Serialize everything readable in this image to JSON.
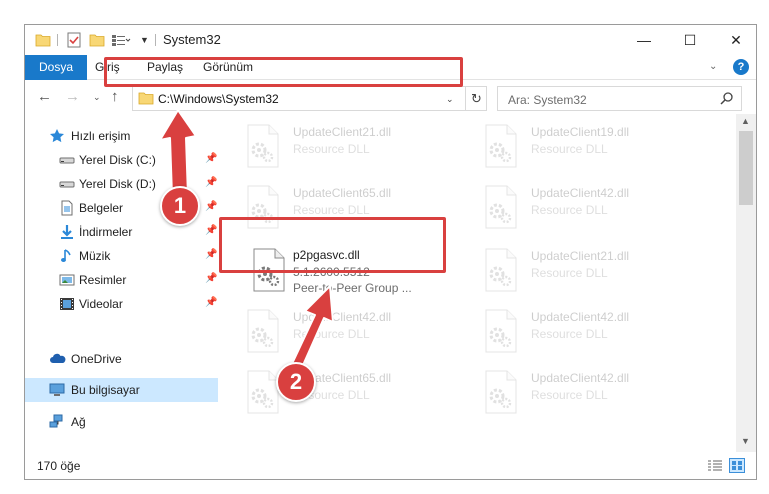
{
  "window": {
    "title": "System32",
    "minimize": "—",
    "maximize": "☐",
    "close": "✕"
  },
  "ribbon": {
    "tabs": [
      "Dosya",
      "Giriş",
      "Paylaş",
      "Görünüm"
    ],
    "expand": "⌄",
    "help": "?"
  },
  "nav": {
    "back": "←",
    "forward": "→",
    "recent": "⌄",
    "up": "↑",
    "address": "C:\\Windows\\System32",
    "address_drop": "⌄",
    "refresh": "↻",
    "search_placeholder": "Ara: System32"
  },
  "sidebar": {
    "items": [
      {
        "label": "Hızlı erişim",
        "icon": "star-icon",
        "pinned": false
      },
      {
        "label": "Yerel Disk (C:)",
        "icon": "drive-icon",
        "pinned": true
      },
      {
        "label": "Yerel Disk (D:)",
        "icon": "drive-icon",
        "pinned": true
      },
      {
        "label": "Belgeler",
        "icon": "documents-icon",
        "pinned": true
      },
      {
        "label": "İndirmeler",
        "icon": "download-icon",
        "pinned": true
      },
      {
        "label": "Müzik",
        "icon": "music-icon",
        "pinned": true
      },
      {
        "label": "Resimler",
        "icon": "pictures-icon",
        "pinned": true
      },
      {
        "label": "Videolar",
        "icon": "video-icon",
        "pinned": true
      },
      {
        "label": "OneDrive",
        "icon": "cloud-icon",
        "pinned": false
      },
      {
        "label": "Bu bilgisayar",
        "icon": "computer-icon",
        "pinned": false
      },
      {
        "label": "Ağ",
        "icon": "network-icon",
        "pinned": false
      }
    ]
  },
  "files": [
    {
      "name": "UpdateClient21.dll",
      "desc": "Resource DLL",
      "desc2": ""
    },
    {
      "name": "UpdateClient19.dll",
      "desc": "Resource DLL",
      "desc2": ""
    },
    {
      "name": "UpdateClient65.dll",
      "desc": "Resource DLL",
      "desc2": ""
    },
    {
      "name": "UpdateClient42.dll",
      "desc": "Resource DLL",
      "desc2": ""
    },
    {
      "name": "p2pgasvc.dll",
      "desc": "5.1.2600.5512",
      "desc2": "Peer-to-Peer Group ..."
    },
    {
      "name": "UpdateClient21.dll",
      "desc": "Resource DLL",
      "desc2": ""
    },
    {
      "name": "UpdateClient42.dll",
      "desc": "Resource DLL",
      "desc2": ""
    },
    {
      "name": "UpdateClient42.dll",
      "desc": "Resource DLL",
      "desc2": ""
    },
    {
      "name": "UpdateClient65.dll",
      "desc": "Resource DLL",
      "desc2": ""
    },
    {
      "name": "UpdateClient42.dll",
      "desc": "Resource DLL",
      "desc2": ""
    }
  ],
  "status": {
    "count": "170 öğe"
  },
  "annotations": {
    "marker1": "1",
    "marker2": "2",
    "color": "#d9403f"
  },
  "colors": {
    "accent": "#1979ca",
    "selection": "#cce8ff"
  }
}
